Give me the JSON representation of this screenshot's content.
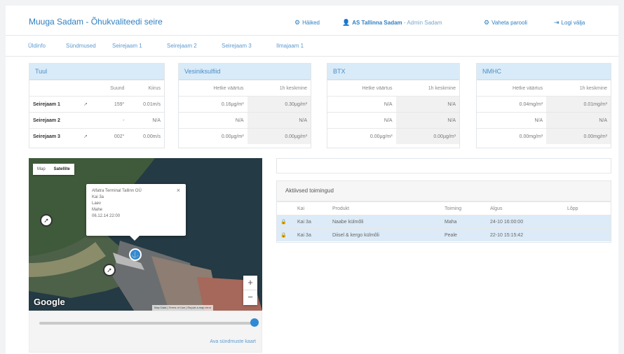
{
  "header": {
    "title": "Muuga Sadam - Õhukvaliteedi seire",
    "links": [
      {
        "icon": "gear-icon",
        "label": "Häiked"
      },
      {
        "icon": "user-icon",
        "user": "AS Tallinna Sadam",
        "role": "- Admin Sadam"
      },
      {
        "icon": "gear-icon",
        "label": "Vaheta parooli"
      },
      {
        "icon": "logout-icon",
        "label": "Logi välja"
      }
    ]
  },
  "tabs": [
    "Üldinfo",
    "Sündmused",
    "Seirejaam 1",
    "Seirejaam 2",
    "Seirejaam 3",
    "Ilmajaam 1"
  ],
  "wind": {
    "title": "Tuul",
    "headers": [
      "Suund",
      "Kiirus"
    ],
    "rows": [
      {
        "name": "Seirejaam 1",
        "dir": "159°",
        "speed": "0.01m/s"
      },
      {
        "name": "Seirejaam 2",
        "dir": "-",
        "speed": "N/A"
      },
      {
        "name": "Seirejaam 3",
        "dir": "002°",
        "speed": "0.00m/s"
      }
    ]
  },
  "metrics": [
    {
      "title": "Vesiniksulfiid",
      "col1": "Hetke väärtus",
      "col2": "1h keskmine",
      "rows": [
        [
          "0.16µg/m³",
          "0.30µg/m³"
        ],
        [
          "N/A",
          "N/A"
        ],
        [
          "0.00µg/m³",
          "0.00µg/m³"
        ]
      ]
    },
    {
      "title": "BTX",
      "col1": "Hetke väärtus",
      "col2": "1h keskmine",
      "rows": [
        [
          "N/A",
          "N/A"
        ],
        [
          "N/A",
          "N/A"
        ],
        [
          "0.00µg/m³",
          "0.00µg/m³"
        ]
      ]
    },
    {
      "title": "NMHC",
      "col1": "Hetke väärtus",
      "col2": "1h keskmine",
      "rows": [
        [
          "0.04mg/m³",
          "0.01mg/m³"
        ],
        [
          "N/A",
          "N/A"
        ],
        [
          "0.00mg/m³",
          "0.00mg/m³"
        ]
      ]
    }
  ],
  "map": {
    "type_map": "Map",
    "type_satellite": "Satellite",
    "popup_lines": [
      "Alfatra Terminal Tallinn OÜ",
      "Kai 3a",
      "Laev",
      "Mahe",
      "06.12.14 22:00"
    ],
    "zoom_in": "+",
    "zoom_out": "−",
    "google": "Google",
    "footer": "Map Data  |  Terms of Use  |  Report a map error",
    "slider_value": 1.0,
    "slider_link": "Ava sündmuste kaart"
  },
  "events": {
    "title": "Aktiivsed toimingud",
    "headers": [
      "Kai",
      "Produkt",
      "Toiming",
      "Algus",
      "Lõpp"
    ],
    "rows": [
      {
        "kai": "Kai 3a",
        "product": "Naabe külmõli",
        "action": "Maha",
        "start": "24-10 16:00:00",
        "end": ""
      },
      {
        "kai": "Kai 3a",
        "product": "Diisel & kergo külmõli",
        "action": "Peale",
        "start": "22-10 15:15:42",
        "end": ""
      }
    ]
  },
  "colors": {
    "accent": "#2f7fc1",
    "panel_header": "#d9ebf8",
    "row_highlight": "#dcebf7",
    "slider": "#2f89d4"
  }
}
